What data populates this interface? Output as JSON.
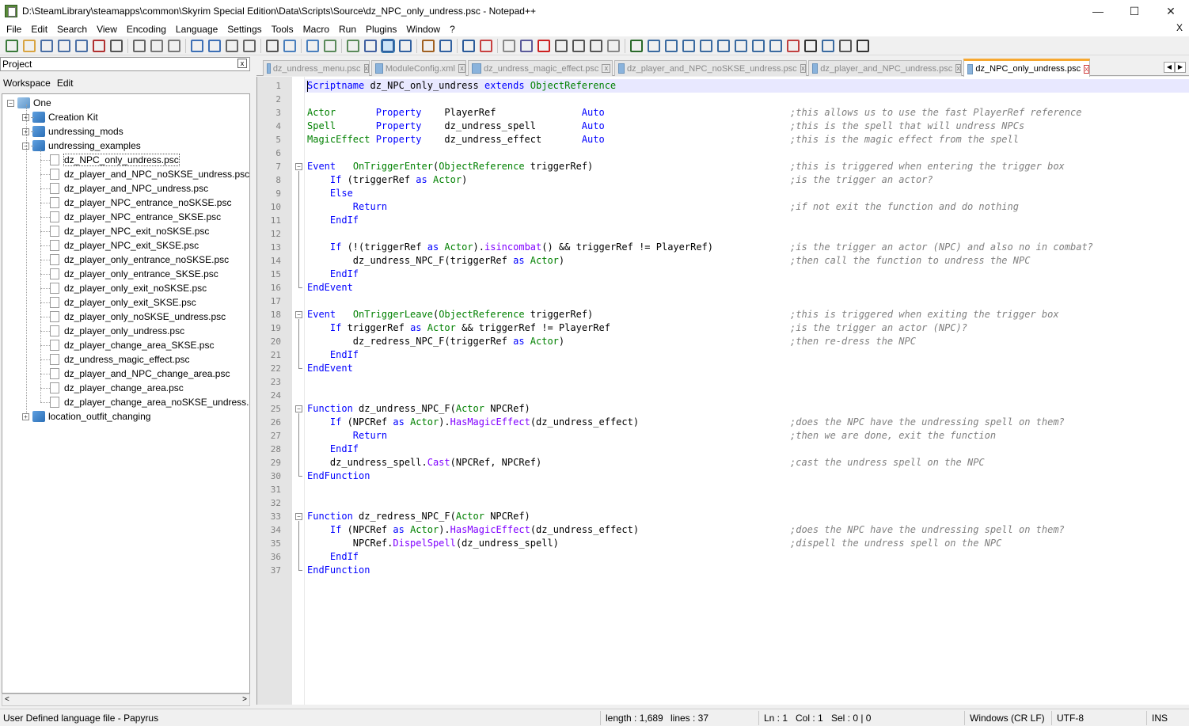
{
  "window": {
    "title": "D:\\SteamLibrary\\steamapps\\common\\Skyrim Special Edition\\Data\\Scripts\\Source\\dz_NPC_only_undress.psc - Notepad++",
    "minimize": "—",
    "maximize": "☐",
    "close": "✕"
  },
  "menu": [
    "File",
    "Edit",
    "Search",
    "View",
    "Encoding",
    "Language",
    "Settings",
    "Tools",
    "Macro",
    "Run",
    "Plugins",
    "Window",
    "?"
  ],
  "menu_close": "X",
  "toolbar_colors": [
    "#3a7a3a",
    "#d9a441",
    "#4a6fa5",
    "#4a6fa5",
    "#4a6fa5",
    "#b03030",
    "#555555",
    "#666666",
    "#777777",
    "#777777",
    "#3d6fb5",
    "#3d6fb5",
    "#666666",
    "#666666",
    "#555555",
    "#4a7fbd",
    "#4a7fbd",
    "#5a8a5a",
    "#5a8a5a",
    "#4060a0",
    "#3060a0",
    "#3060a0",
    "#a06020",
    "#3060a0",
    "#2a5a9a",
    "#c84040",
    "#888888",
    "#5a5a9a",
    "#cc2020",
    "#555555",
    "#555555",
    "#555555",
    "#888888",
    "#2a6a2a",
    "#3a6aa0",
    "#3a6aa0",
    "#3a6aa0",
    "#3a6aa0",
    "#3a6aa0",
    "#3a6aa0",
    "#3a6aa0",
    "#3a6aa0",
    "#c04040",
    "#333333",
    "#3a6aa0",
    "#555555",
    "#333333"
  ],
  "project_panel": {
    "title": "Project",
    "close": "x",
    "workspace_menu": [
      "Workspace",
      "Edit"
    ],
    "root": "One",
    "folders": [
      {
        "name": "Creation Kit",
        "expanded": false
      },
      {
        "name": "undressing_mods",
        "expanded": false
      },
      {
        "name": "undressing_examples",
        "expanded": true
      }
    ],
    "files": [
      "dz_NPC_only_undress.psc",
      "dz_player_and_NPC_noSKSE_undress.psc",
      "dz_player_and_NPC_undress.psc",
      "dz_player_NPC_entrance_noSKSE.psc",
      "dz_player_NPC_entrance_SKSE.psc",
      "dz_player_NPC_exit_noSKSE.psc",
      "dz_player_NPC_exit_SKSE.psc",
      "dz_player_only_entrance_noSKSE.psc",
      "dz_player_only_entrance_SKSE.psc",
      "dz_player_only_exit_noSKSE.psc",
      "dz_player_only_exit_SKSE.psc",
      "dz_player_only_noSKSE_undress.psc",
      "dz_player_only_undress.psc",
      "dz_player_change_area_SKSE.psc",
      "dz_undress_magic_effect.psc",
      "dz_player_and_NPC_change_area.psc",
      "dz_player_change_area.psc",
      "dz_player_change_area_noSKSE_undress.psc"
    ],
    "last_folder": "location_outfit_changing"
  },
  "tabs": [
    {
      "label": "dz_undress_menu.psc",
      "active": false
    },
    {
      "label": "ModuleConfig.xml",
      "active": false
    },
    {
      "label": "dz_undress_magic_effect.psc",
      "active": false
    },
    {
      "label": "dz_player_and_NPC_noSKSE_undress.psc",
      "active": false
    },
    {
      "label": "dz_player_and_NPC_undress.psc",
      "active": false
    },
    {
      "label": "dz_NPC_only_undress.psc",
      "active": true
    }
  ],
  "tab_close": "x",
  "tab_nav": [
    "◀",
    "▶"
  ],
  "code": [
    {
      "n": "1",
      "t": "Scriptname dz_NPC_only_undress extends ObjectReference",
      "c": ""
    },
    {
      "n": "2",
      "t": "",
      "c": ""
    },
    {
      "n": "3",
      "t": "Actor       Property    PlayerRef               Auto",
      "c": ";this allows us to use the fast PlayerRef reference"
    },
    {
      "n": "4",
      "t": "Spell       Property    dz_undress_spell        Auto",
      "c": ";this is the spell that will undress NPCs"
    },
    {
      "n": "5",
      "t": "MagicEffect Property    dz_undress_effect       Auto",
      "c": ";this is the magic effect from the spell"
    },
    {
      "n": "6",
      "t": "",
      "c": ""
    },
    {
      "n": "7",
      "t": "Event   OnTriggerEnter(ObjectReference triggerRef)",
      "c": ";this is triggered when entering the trigger box"
    },
    {
      "n": "8",
      "t": "    If (triggerRef as Actor)",
      "c": ";is the trigger an actor?"
    },
    {
      "n": "9",
      "t": "    Else",
      "c": ""
    },
    {
      "n": "10",
      "t": "        Return",
      "c": ";if not exit the function and do nothing"
    },
    {
      "n": "11",
      "t": "    EndIf",
      "c": ""
    },
    {
      "n": "12",
      "t": "",
      "c": ""
    },
    {
      "n": "13",
      "t": "    If (!(triggerRef as Actor).isincombat() && triggerRef != PlayerRef)",
      "c": ";is the trigger an actor (NPC) and also no in combat?"
    },
    {
      "n": "14",
      "t": "        dz_undress_NPC_F(triggerRef as Actor)",
      "c": ";then call the function to undress the NPC"
    },
    {
      "n": "15",
      "t": "    EndIf",
      "c": ""
    },
    {
      "n": "16",
      "t": "EndEvent",
      "c": ""
    },
    {
      "n": "17",
      "t": "",
      "c": ""
    },
    {
      "n": "18",
      "t": "Event   OnTriggerLeave(ObjectReference triggerRef)",
      "c": ";this is triggered when exiting the trigger box"
    },
    {
      "n": "19",
      "t": "    If triggerRef as Actor && triggerRef != PlayerRef",
      "c": ";is the trigger an actor (NPC)?"
    },
    {
      "n": "20",
      "t": "        dz_redress_NPC_F(triggerRef as Actor)",
      "c": ";then re-dress the NPC"
    },
    {
      "n": "21",
      "t": "    EndIf",
      "c": ""
    },
    {
      "n": "22",
      "t": "EndEvent",
      "c": ""
    },
    {
      "n": "23",
      "t": "",
      "c": ""
    },
    {
      "n": "24",
      "t": "",
      "c": ""
    },
    {
      "n": "25",
      "t": "Function dz_undress_NPC_F(Actor NPCRef)",
      "c": ""
    },
    {
      "n": "26",
      "t": "    If (NPCRef as Actor).HasMagicEffect(dz_undress_effect)",
      "c": ";does the NPC have the undressing spell on them?"
    },
    {
      "n": "27",
      "t": "        Return",
      "c": ";then we are done, exit the function"
    },
    {
      "n": "28",
      "t": "    EndIf",
      "c": ""
    },
    {
      "n": "29",
      "t": "    dz_undress_spell.Cast(NPCRef, NPCRef)",
      "c": ";cast the undress spell on the NPC"
    },
    {
      "n": "30",
      "t": "EndFunction",
      "c": ""
    },
    {
      "n": "31",
      "t": "",
      "c": ""
    },
    {
      "n": "32",
      "t": "",
      "c": ""
    },
    {
      "n": "33",
      "t": "Function dz_redress_NPC_F(Actor NPCRef)",
      "c": ""
    },
    {
      "n": "34",
      "t": "    If (NPCRef as Actor).HasMagicEffect(dz_undress_effect)",
      "c": ";does the NPC have the undressing spell on them?"
    },
    {
      "n": "35",
      "t": "        NPCRef.DispelSpell(dz_undress_spell)",
      "c": ";dispell the undress spell on the NPC"
    },
    {
      "n": "36",
      "t": "    EndIf",
      "c": ""
    },
    {
      "n": "37",
      "t": "EndFunction",
      "c": ""
    }
  ],
  "status": {
    "language": "User Defined language file - Papyrus",
    "length": "length : 1,689",
    "lines": "lines : 37",
    "ln": "Ln : 1",
    "col": "Col : 1",
    "sel": "Sel : 0 | 0",
    "eol": "Windows (CR LF)",
    "encoding": "UTF-8",
    "mode": "INS"
  }
}
